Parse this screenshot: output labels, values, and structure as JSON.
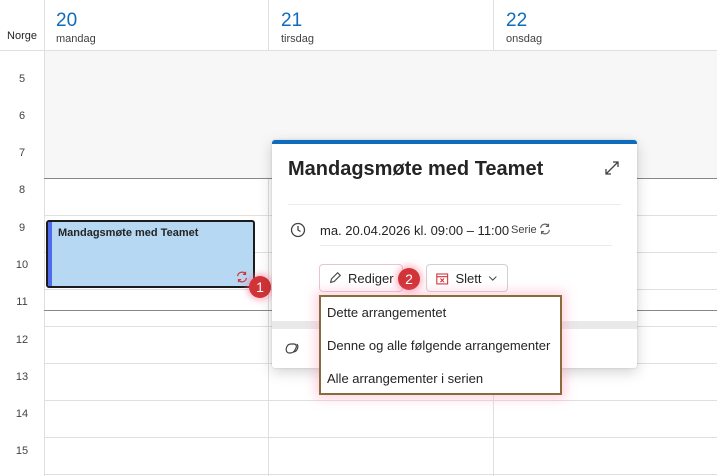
{
  "timezone": "Norge",
  "days": [
    {
      "number": "20",
      "name": "mandag"
    },
    {
      "number": "21",
      "name": "tirsdag"
    },
    {
      "number": "22",
      "name": "onsdag"
    }
  ],
  "hours": [
    "5",
    "6",
    "7",
    "8",
    "9",
    "10",
    "11",
    "12",
    "13",
    "14",
    "15"
  ],
  "event": {
    "title": "Mandagsmøte med Teamet",
    "recurring_icon": "recurring-icon"
  },
  "badges": [
    "1",
    "2"
  ],
  "popup": {
    "title": "Mandagsmøte med Teamet",
    "datetime": "ma. 20.04.2026 kl. 09:00 – 11:00",
    "serie_label": "Serie",
    "edit_label": "Rediger",
    "delete_label": "Slett",
    "accent_color": "#0f6cbd"
  },
  "menu": {
    "items": [
      {
        "label": "Dette arrangementet"
      },
      {
        "label": "Denne og alle følgende arrangementer"
      },
      {
        "label": "Alle arrangementer i serien"
      }
    ]
  },
  "colors": {
    "event_fill": "#b6d8f2",
    "badge": "#d13438"
  }
}
